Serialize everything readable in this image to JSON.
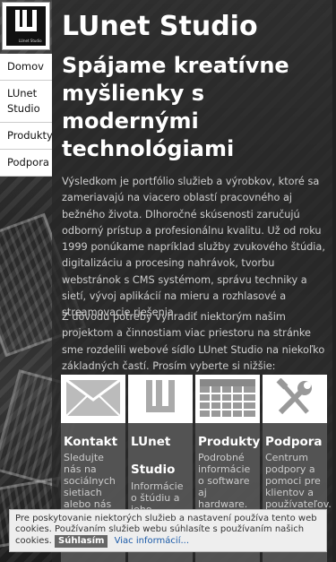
{
  "site": {
    "title": "LUnet Studio",
    "logo_tagline": "LUnet Studio",
    "slogan": "Spájame kreatívne myšlienky s modernými technológiami"
  },
  "nav": {
    "items": [
      {
        "label": "Domov"
      },
      {
        "label": "LUnet Studio"
      },
      {
        "label": "Produkty"
      },
      {
        "label": "Podpora"
      }
    ]
  },
  "content": {
    "paragraph1": "Výsledkom je portfólio služieb a výrobkov, ktoré sa zameriavajú na viacero oblastí pracovného aj bežného života. Dlhoročné skúsenosti zaručujú odborný prístup a profesionálnu kvalitu. Už od roku 1999 ponúkame napríklad služby zvukového štúdia, digitalizáciu a procesing nahrávok, tvorbu webstránok s CMS systémom, správu techniky a sietí, vývoj aplikácií na mieru a rozhlasové a streamovacie riešenia.",
    "paragraph2": "Z dôvodu potreby vyhradiť niektorým našim projektom a činnostiam viac priestoru na stránke sme rozdelili webové sídlo LUnet Studio na niekoľko základných častí. Prosím vyberte si nižšie:"
  },
  "tiles": [
    {
      "title": "Kontakt",
      "desc": "Sledujte nás na sociálnych sietiach alebo nás kontaktujte.",
      "icon": "envelope-icon"
    },
    {
      "title": "LUnet Studio",
      "desc": "Informácie o štúdiu a jeho službách.",
      "icon": "lunet-logo-icon"
    },
    {
      "title": "Produkty",
      "desc": "Podrobné informácie o software aj hardware.",
      "icon": "table-icon"
    },
    {
      "title": "Podpora",
      "desc": "Centrum podpory a pomoci pre klientov a používateľov.",
      "icon": "tools-icon"
    }
  ],
  "cookie": {
    "text": "Pre poskytovanie niektorých služieb a nastavení používa tento web cookies. Používaním služieb webu súhlasíte s používaním našich cookies.",
    "accept_label": "Súhlasím",
    "more_label": "Viac informácií..."
  }
}
